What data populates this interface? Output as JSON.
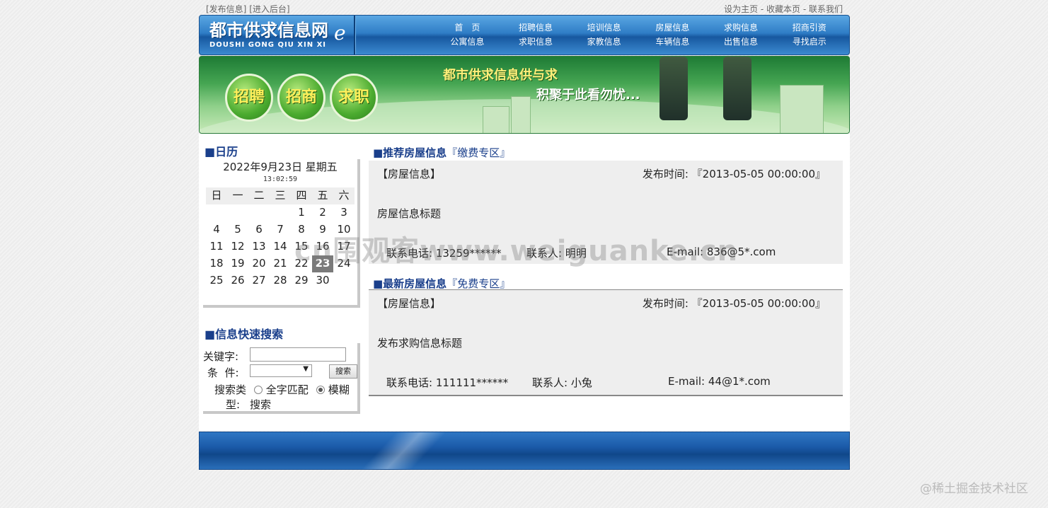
{
  "top_links": {
    "left": [
      "[发布信息]",
      "[进入后台]"
    ],
    "right": "设为主页 - 收藏本页 - 联系我们"
  },
  "logo": {
    "main": "都市供求信息网",
    "letter": "e",
    "sub": "DOUSHI GONG QIU XIN XI"
  },
  "nav": {
    "row1": [
      "首　页",
      "招聘信息",
      "培训信息",
      "房屋信息",
      "求购信息",
      "招商引资"
    ],
    "row2": [
      "公寓信息",
      "求职信息",
      "家教信息",
      "车辆信息",
      "出售信息",
      "寻找启示"
    ]
  },
  "banner": {
    "buttons": [
      "招聘",
      "招商",
      "求职"
    ],
    "slogan1": "都市供求信息供与求",
    "slogan2": "积聚于此看勿忧..."
  },
  "calendar": {
    "heading": "■日历",
    "date": "2022年9月23日  星期五",
    "time": "13:02:59",
    "weekdays": [
      "日",
      "一",
      "二",
      "三",
      "四",
      "五",
      "六"
    ],
    "weeks": [
      [
        "",
        "",
        "",
        "",
        "1",
        "2",
        "3"
      ],
      [
        "4",
        "5",
        "6",
        "7",
        "8",
        "9",
        "10"
      ],
      [
        "11",
        "12",
        "13",
        "14",
        "15",
        "16",
        "17"
      ],
      [
        "18",
        "19",
        "20",
        "21",
        "22",
        "23",
        "24"
      ],
      [
        "25",
        "26",
        "27",
        "28",
        "29",
        "30",
        ""
      ]
    ],
    "today": "23"
  },
  "search": {
    "heading": "■信息快速搜索",
    "keyword_label": "关键字:",
    "condition_label": "条  件:",
    "button": "搜索",
    "type_label_1": "搜索类",
    "type_label_2": "型:",
    "opt_exact": "全字匹配",
    "opt_fuzzy": "模糊",
    "opt_fuzzy_2": "搜索"
  },
  "sections": [
    {
      "heading": "■推荐房屋信息",
      "zone": "『缴费专区』",
      "category": "【房屋信息】",
      "time": "发布时间: 『2013-05-05 00:00:00』",
      "title": "房屋信息标题",
      "phone": "联系电话: 13259******",
      "person": "联系人: 明明",
      "email": "E-mail: 836@5*.com"
    },
    {
      "heading": "■最新房屋信息",
      "zone": "『免费专区』",
      "category": "【房屋信息】",
      "time": "发布时间: 『2013-05-05 00:00:00』",
      "title": "发布求购信息标题",
      "phone": "联系电话: 111111******",
      "person": "联系人: 小兔",
      "email": "E-mail: 44@1*.com"
    }
  ],
  "watermark_center": "cn围观客www.weiguanke.cn",
  "watermark_corner": "@稀土掘金技术社区"
}
